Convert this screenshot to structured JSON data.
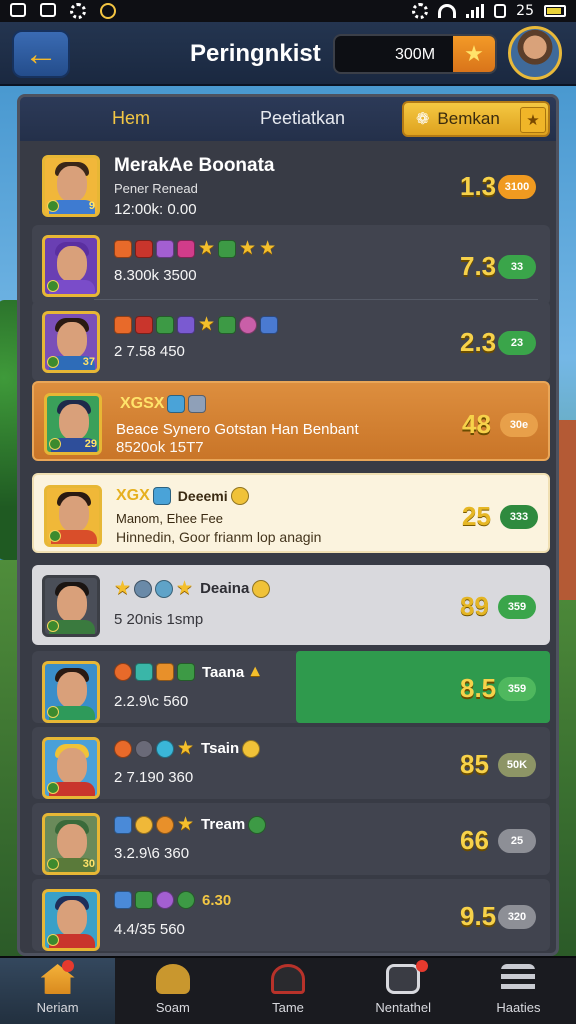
{
  "status_bar": {
    "time": "25"
  },
  "header": {
    "title": "Peringnkist",
    "coin_value": "300M",
    "plus_icon": "star-icon"
  },
  "tabs": {
    "hem": "Hem",
    "per": "Peetiatkan",
    "bemkan": "Bemkan"
  },
  "rows": [
    {
      "name": "MerakAe Boonata",
      "sub": "Pener Renead",
      "meta": "12:00k: 0.00",
      "score": "1.3",
      "pill": "3100",
      "pill_color": "orange"
    },
    {
      "icons_label": "",
      "meta": "8.300k 3500",
      "score": "7.3",
      "pill": "33",
      "pill_color": "green"
    },
    {
      "icons_label": "",
      "meta": "2 7.58 450",
      "score": "2.3",
      "pill": "23",
      "pill_color": "green"
    },
    {
      "name": "XGSX",
      "sub": "Beace Synero Gotstan Han Benbant",
      "meta": "8520ok 15T7",
      "score": "48",
      "pill": "30e",
      "pill_color": "orange"
    },
    {
      "name": "XGX",
      "tag": "Deeemi",
      "sub": "Manom, Ehee Fee",
      "meta": "Hinnedin, Goor frianm lop anagin",
      "score": "25",
      "pill": "333",
      "pill_color": "green"
    },
    {
      "tag": "Deaina",
      "meta": "5 20nis 1smp",
      "score": "89",
      "pill": "359",
      "pill_color": "green"
    },
    {
      "tag": "Taana",
      "meta": "2.2.9\\c 560",
      "score": "8.5",
      "pill": "359",
      "pill_color": "green"
    },
    {
      "tag": "Tsain",
      "meta": "2 7.190 360",
      "score": "85",
      "pill": "50K",
      "pill_color": "olive"
    },
    {
      "tag": "Tream",
      "meta": "3.2.9\\6 360",
      "score": "66",
      "pill": "25",
      "pill_color": "grey"
    },
    {
      "tag": "6.30",
      "meta": "4.4/35 560",
      "score": "9.5",
      "pill": "320",
      "pill_color": "grey"
    }
  ],
  "nav": [
    {
      "label": "Neriam",
      "icon": "home-icon"
    },
    {
      "label": "Soam",
      "icon": "team-icon"
    },
    {
      "label": "Tame",
      "icon": "helmet-icon"
    },
    {
      "label": "Nentathel",
      "icon": "camera-icon"
    },
    {
      "label": "Haaties",
      "icon": "settings-icon"
    }
  ]
}
